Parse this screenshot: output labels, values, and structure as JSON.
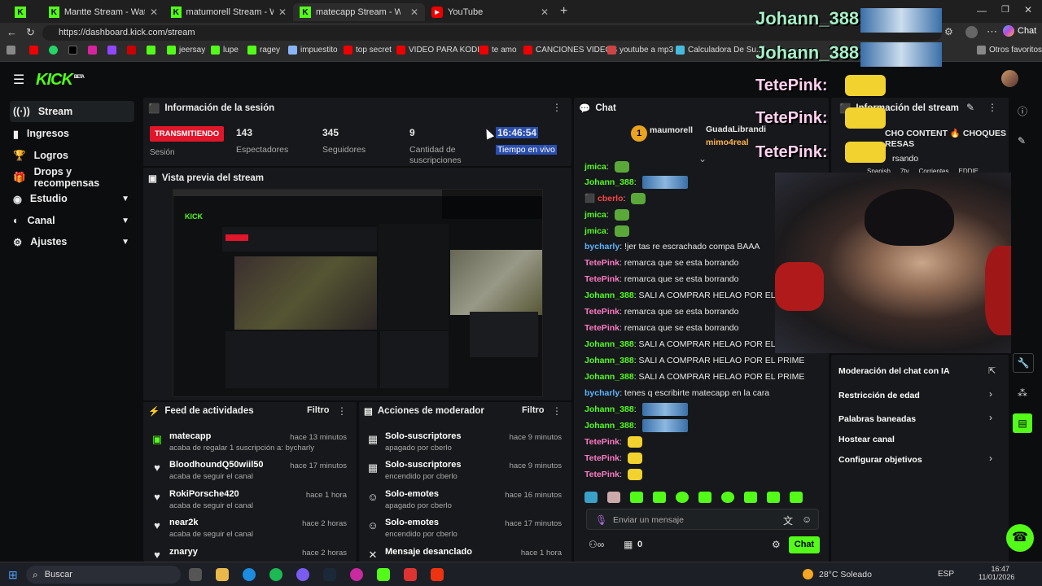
{
  "browser": {
    "tabs": [
      {
        "title": "Mantte Stream - Watch Live o"
      },
      {
        "title": "matumorell Stream - Watch Live o"
      },
      {
        "title": "matecapp Stream - Watch Live o"
      },
      {
        "title": "YouTube"
      }
    ],
    "url": "https://dashboard.kick.com/stream",
    "bookmarks": [
      "jeersay",
      "lupe",
      "ragey",
      "impuestito",
      "top secret",
      "VIDEO PARA KODI...",
      "te amo",
      "CANCIONES VIDEOS",
      "youtube a mp3",
      "Calculadora De Su...",
      "Otros favoritos"
    ],
    "chat_button": "Chat"
  },
  "kick": {
    "logo": "KICK",
    "logo_tag": "BETA",
    "nav": [
      {
        "label": "Stream"
      },
      {
        "label": "Ingresos"
      },
      {
        "label": "Logros"
      },
      {
        "label": "Drops y recompensas"
      },
      {
        "label": "Estudio"
      },
      {
        "label": "Canal"
      },
      {
        "label": "Ajustes"
      }
    ],
    "session": {
      "title": "Información de la sesión",
      "status": "TRANSMITIENDO",
      "status_label": "Sesión",
      "viewers": "143",
      "viewers_label": "Espectadores",
      "followers": "345",
      "followers_label": "Seguidores",
      "subs": "9",
      "subs_label": "Cantidad de suscripciones",
      "uptime": "16:46:54",
      "uptime_label": "Tiempo en vivo"
    },
    "preview_title": "Vista previa del stream",
    "feed": {
      "title": "Feed de actividades",
      "filter": "Filtro",
      "items": [
        {
          "name": "matecapp",
          "time": "hace 13 minutos",
          "sub": "acaba de regalar 1 suscripción a: bycharly"
        },
        {
          "name": "BloodhoundQ50wiil50",
          "time": "hace 17 minutos",
          "sub": "acaba de seguir el canal"
        },
        {
          "name": "RokiPorsche420",
          "time": "hace 1 hora",
          "sub": "acaba de seguir el canal"
        },
        {
          "name": "near2k",
          "time": "hace 2 horas",
          "sub": "acaba de seguir el canal"
        },
        {
          "name": "znaryy",
          "time": "hace 2 horas",
          "sub": ""
        }
      ]
    },
    "mod": {
      "title": "Acciones de moderador",
      "filter": "Filtro",
      "items": [
        {
          "name": "Solo-suscriptores",
          "time": "hace 9 minutos",
          "sub": "apagado por cberlo"
        },
        {
          "name": "Solo-suscriptores",
          "time": "hace 9 minutos",
          "sub": "encendido por cberlo"
        },
        {
          "name": "Solo-emotes",
          "time": "hace 16 minutos",
          "sub": "apagado por cberlo"
        },
        {
          "name": "Solo-emotes",
          "time": "hace 17 minutos",
          "sub": "encendido por cberlo"
        },
        {
          "name": "Mensaje desanclado",
          "time": "hace 1 hora",
          "sub": ""
        }
      ]
    },
    "chat": {
      "title": "Chat",
      "pinned_1": "maumorell",
      "pinned_2": "GuadaLibrandi",
      "pinned_3": "mimo4real",
      "lines": [
        {
          "user": "jmica",
          "text": ""
        },
        {
          "user": "Johann_388",
          "text": ""
        },
        {
          "user": "cberlo",
          "text": ""
        },
        {
          "user": "jmica",
          "text": ""
        },
        {
          "user": "jmica",
          "text": ""
        },
        {
          "user": "bycharly",
          "text": "!jer tas re escrachado compa BAAA"
        },
        {
          "user": "TetePink",
          "text": "remarca que se esta borrando"
        },
        {
          "user": "TetePink",
          "text": "remarca que se esta borrando"
        },
        {
          "user": "Johann_388",
          "text": "SALI A COMPRAR HELAO POR EL PRIME"
        },
        {
          "user": "TetePink",
          "text": "remarca que se esta borrando"
        },
        {
          "user": "TetePink",
          "text": "remarca que se esta borrando"
        },
        {
          "user": "Johann_388",
          "text": "SALI A COMPRAR HELAO POR EL PRIME"
        },
        {
          "user": "Johann_388",
          "text": "SALI A COMPRAR HELAO POR EL PRIME"
        },
        {
          "user": "Johann_388",
          "text": "SALI A COMPRAR HELAO POR EL PRIME"
        },
        {
          "user": "bycharly",
          "text": "tenes q escribirte matecapp en la cara"
        },
        {
          "user": "Johann_388",
          "text": ""
        },
        {
          "user": "Johann_388",
          "text": ""
        },
        {
          "user": "TetePink",
          "text": ""
        },
        {
          "user": "TetePink",
          "text": ""
        },
        {
          "user": "TetePink",
          "text": ""
        }
      ],
      "input_placeholder": "Enviar un mensaje",
      "count": "0",
      "send": "Chat"
    },
    "stream_info": {
      "title": "Información del stream",
      "stream_title_part": "CHO CONTENT 🔥 CHOQUES",
      "stream_title_part2": "RESAS",
      "category_part": "rsando",
      "tags": [
        "Spanish",
        "7tv",
        "Corrientes",
        "EDDIE"
      ],
      "menu": [
        "Moderación del chat con IA",
        "Restricción de edad",
        "Palabras baneadas",
        "Hostear canal",
        "Configurar objetivos"
      ]
    },
    "overlay": [
      "Johann_388:",
      "Johann_388:",
      "TetePink:",
      "TetePink:",
      "TetePink:"
    ]
  },
  "taskbar": {
    "search": "Buscar",
    "weather": "28°C",
    "weather_text": "Soleado",
    "lang": "ESP",
    "time": "16:47",
    "date": "11/01/2026"
  },
  "colors": {
    "kick_green": "#53fc18",
    "live_red": "#e0162b",
    "panel": "#16181b",
    "bg": "#0b0d0f"
  }
}
